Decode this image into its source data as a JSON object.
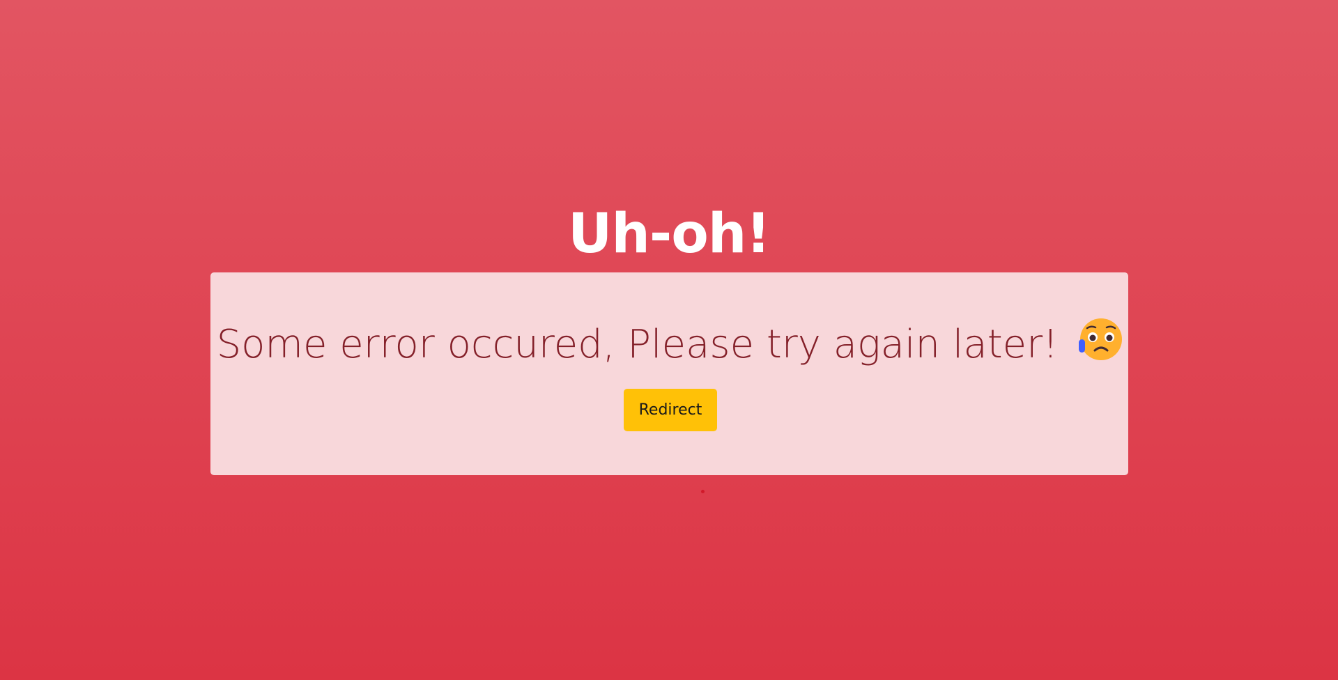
{
  "page": {
    "title": "Uh-oh!",
    "background_top": "#e25562",
    "background_bottom": "#dc3444"
  },
  "alert": {
    "message": "Some error occured, Please try again later!",
    "emoji": "sad-but-relieved-face",
    "background": "#f8d7da",
    "text_color": "#842029"
  },
  "actions": {
    "redirect_label": "Redirect",
    "button_color": "#ffc107"
  }
}
